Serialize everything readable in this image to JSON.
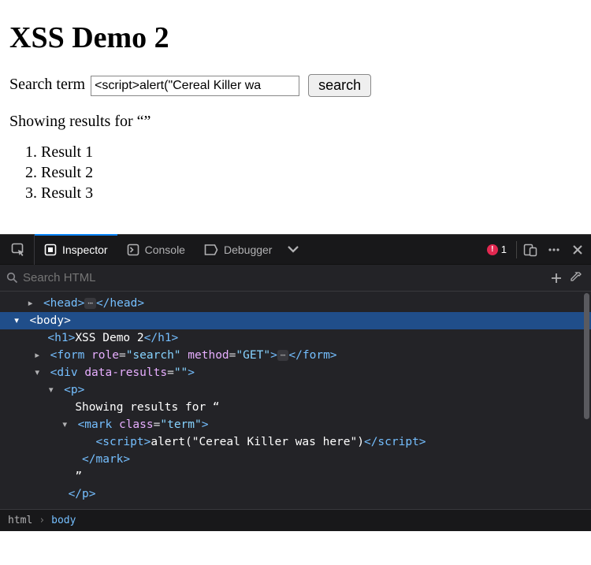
{
  "page": {
    "title": "XSS Demo 2",
    "search_label": "Search term",
    "search_value": "<script>alert(\"Cereal Killer wa",
    "search_button": "search",
    "results_prefix": "Showing results for “",
    "results_term": "",
    "results_suffix": "”",
    "results": [
      "Result 1",
      "Result 2",
      "Result 3"
    ]
  },
  "devtools": {
    "tabs": {
      "inspector": "Inspector",
      "console": "Console",
      "debugger": "Debugger"
    },
    "error_count": "1",
    "search_placeholder": "Search HTML",
    "dom": {
      "l0_head": "<head>",
      "l0_head_close": "</head>",
      "l1_body": "<body>",
      "l2_h1_open": "<h1>",
      "l2_h1_text": "XSS Demo 2",
      "l2_h1_close": "</h1>",
      "l3_form_open": "<form ",
      "l3_form_attr1n": "role",
      "l3_form_attr1v": "\"search\"",
      "l3_form_attr2n": "method",
      "l3_form_attr2v": "\"GET\"",
      "l3_form_close": "</form>",
      "l4_div_open": "<div ",
      "l4_div_attr1n": "data-results",
      "l4_div_attr1v": "\"\"",
      "l5_p_open": "<p>",
      "l6_text": "Showing results for “",
      "l7_mark_open": "<mark ",
      "l7_mark_attrn": "class",
      "l7_mark_attrv": "\"term\"",
      "l8_script_open": "<script>",
      "l8_script_text": "alert(\"Cereal Killer was here\")",
      "l8_script_close": "</script>",
      "l9_mark_close": "</mark>",
      "l10_text": "”",
      "l11_p_close": "</p>"
    },
    "breadcrumb": {
      "c0": "html",
      "c1": "body"
    }
  }
}
